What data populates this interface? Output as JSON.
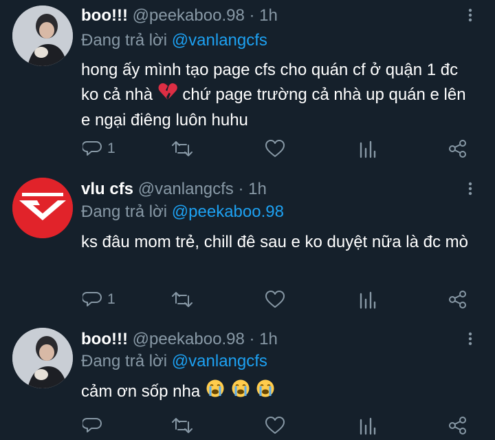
{
  "tweets": [
    {
      "display_name": "boo!!!",
      "handle_meta": "@peekaboo.98 · 1h",
      "reply_prefix": "Đang trả lời",
      "reply_to": "@vanlangcfs",
      "text_part1": "hong ấy mình tạo page cfs cho quán cf ở quận 1 đc ko cả nhà",
      "text_part2": "chứ page trường cả nhà up quán e lên e ngại điêng luôn huhu",
      "reply_count": "1",
      "avatar": "user-photo-avatar"
    },
    {
      "display_name": "vlu cfs",
      "handle_meta": "@vanlangcfs · 1h",
      "reply_prefix": "Đang trả lời",
      "reply_to": "@peekaboo.98",
      "text": "ks đâu mom trẻ, chill đê sau e ko duyệt nữa là đc mò",
      "reply_count": "1",
      "avatar": "vlu-logo-avatar"
    },
    {
      "display_name": "boo!!!",
      "handle_meta": "@peekaboo.98 · 1h",
      "reply_prefix": "Đang trả lời",
      "reply_to": "@vanlangcfs",
      "text": "cảm ơn sốp nha",
      "reply_count": "",
      "avatar": "user-photo-avatar"
    }
  ],
  "colors": {
    "background": "#15202b",
    "secondary_text": "#8899a6",
    "accent": "#1da1f2",
    "primary_text": "#ffffff"
  },
  "icons": [
    "reply-icon",
    "retweet-icon",
    "like-icon",
    "analytics-icon",
    "share-icon",
    "more-icon",
    "broken-heart-icon",
    "crying-face-icon"
  ]
}
